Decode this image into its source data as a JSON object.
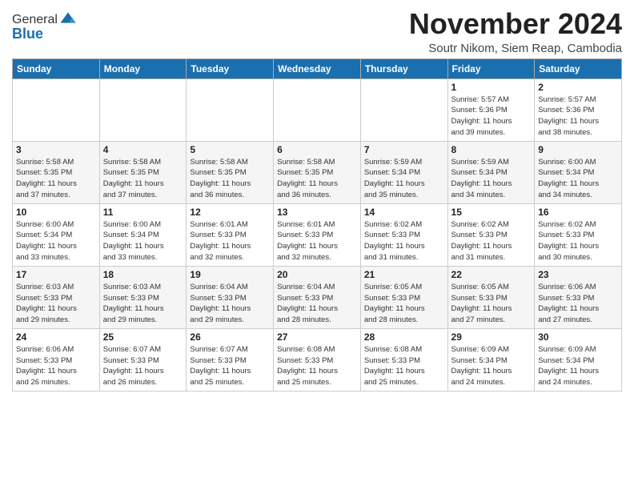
{
  "logo": {
    "general": "General",
    "blue": "Blue"
  },
  "header": {
    "month_year": "November 2024",
    "location": "Soutr Nikom, Siem Reap, Cambodia"
  },
  "weekdays": [
    "Sunday",
    "Monday",
    "Tuesday",
    "Wednesday",
    "Thursday",
    "Friday",
    "Saturday"
  ],
  "weeks": [
    [
      {
        "day": "",
        "info": ""
      },
      {
        "day": "",
        "info": ""
      },
      {
        "day": "",
        "info": ""
      },
      {
        "day": "",
        "info": ""
      },
      {
        "day": "",
        "info": ""
      },
      {
        "day": "1",
        "info": "Sunrise: 5:57 AM\nSunset: 5:36 PM\nDaylight: 11 hours\nand 39 minutes."
      },
      {
        "day": "2",
        "info": "Sunrise: 5:57 AM\nSunset: 5:36 PM\nDaylight: 11 hours\nand 38 minutes."
      }
    ],
    [
      {
        "day": "3",
        "info": "Sunrise: 5:58 AM\nSunset: 5:35 PM\nDaylight: 11 hours\nand 37 minutes."
      },
      {
        "day": "4",
        "info": "Sunrise: 5:58 AM\nSunset: 5:35 PM\nDaylight: 11 hours\nand 37 minutes."
      },
      {
        "day": "5",
        "info": "Sunrise: 5:58 AM\nSunset: 5:35 PM\nDaylight: 11 hours\nand 36 minutes."
      },
      {
        "day": "6",
        "info": "Sunrise: 5:58 AM\nSunset: 5:35 PM\nDaylight: 11 hours\nand 36 minutes."
      },
      {
        "day": "7",
        "info": "Sunrise: 5:59 AM\nSunset: 5:34 PM\nDaylight: 11 hours\nand 35 minutes."
      },
      {
        "day": "8",
        "info": "Sunrise: 5:59 AM\nSunset: 5:34 PM\nDaylight: 11 hours\nand 34 minutes."
      },
      {
        "day": "9",
        "info": "Sunrise: 6:00 AM\nSunset: 5:34 PM\nDaylight: 11 hours\nand 34 minutes."
      }
    ],
    [
      {
        "day": "10",
        "info": "Sunrise: 6:00 AM\nSunset: 5:34 PM\nDaylight: 11 hours\nand 33 minutes."
      },
      {
        "day": "11",
        "info": "Sunrise: 6:00 AM\nSunset: 5:34 PM\nDaylight: 11 hours\nand 33 minutes."
      },
      {
        "day": "12",
        "info": "Sunrise: 6:01 AM\nSunset: 5:33 PM\nDaylight: 11 hours\nand 32 minutes."
      },
      {
        "day": "13",
        "info": "Sunrise: 6:01 AM\nSunset: 5:33 PM\nDaylight: 11 hours\nand 32 minutes."
      },
      {
        "day": "14",
        "info": "Sunrise: 6:02 AM\nSunset: 5:33 PM\nDaylight: 11 hours\nand 31 minutes."
      },
      {
        "day": "15",
        "info": "Sunrise: 6:02 AM\nSunset: 5:33 PM\nDaylight: 11 hours\nand 31 minutes."
      },
      {
        "day": "16",
        "info": "Sunrise: 6:02 AM\nSunset: 5:33 PM\nDaylight: 11 hours\nand 30 minutes."
      }
    ],
    [
      {
        "day": "17",
        "info": "Sunrise: 6:03 AM\nSunset: 5:33 PM\nDaylight: 11 hours\nand 29 minutes."
      },
      {
        "day": "18",
        "info": "Sunrise: 6:03 AM\nSunset: 5:33 PM\nDaylight: 11 hours\nand 29 minutes."
      },
      {
        "day": "19",
        "info": "Sunrise: 6:04 AM\nSunset: 5:33 PM\nDaylight: 11 hours\nand 29 minutes."
      },
      {
        "day": "20",
        "info": "Sunrise: 6:04 AM\nSunset: 5:33 PM\nDaylight: 11 hours\nand 28 minutes."
      },
      {
        "day": "21",
        "info": "Sunrise: 6:05 AM\nSunset: 5:33 PM\nDaylight: 11 hours\nand 28 minutes."
      },
      {
        "day": "22",
        "info": "Sunrise: 6:05 AM\nSunset: 5:33 PM\nDaylight: 11 hours\nand 27 minutes."
      },
      {
        "day": "23",
        "info": "Sunrise: 6:06 AM\nSunset: 5:33 PM\nDaylight: 11 hours\nand 27 minutes."
      }
    ],
    [
      {
        "day": "24",
        "info": "Sunrise: 6:06 AM\nSunset: 5:33 PM\nDaylight: 11 hours\nand 26 minutes."
      },
      {
        "day": "25",
        "info": "Sunrise: 6:07 AM\nSunset: 5:33 PM\nDaylight: 11 hours\nand 26 minutes."
      },
      {
        "day": "26",
        "info": "Sunrise: 6:07 AM\nSunset: 5:33 PM\nDaylight: 11 hours\nand 25 minutes."
      },
      {
        "day": "27",
        "info": "Sunrise: 6:08 AM\nSunset: 5:33 PM\nDaylight: 11 hours\nand 25 minutes."
      },
      {
        "day": "28",
        "info": "Sunrise: 6:08 AM\nSunset: 5:33 PM\nDaylight: 11 hours\nand 25 minutes."
      },
      {
        "day": "29",
        "info": "Sunrise: 6:09 AM\nSunset: 5:34 PM\nDaylight: 11 hours\nand 24 minutes."
      },
      {
        "day": "30",
        "info": "Sunrise: 6:09 AM\nSunset: 5:34 PM\nDaylight: 11 hours\nand 24 minutes."
      }
    ]
  ]
}
